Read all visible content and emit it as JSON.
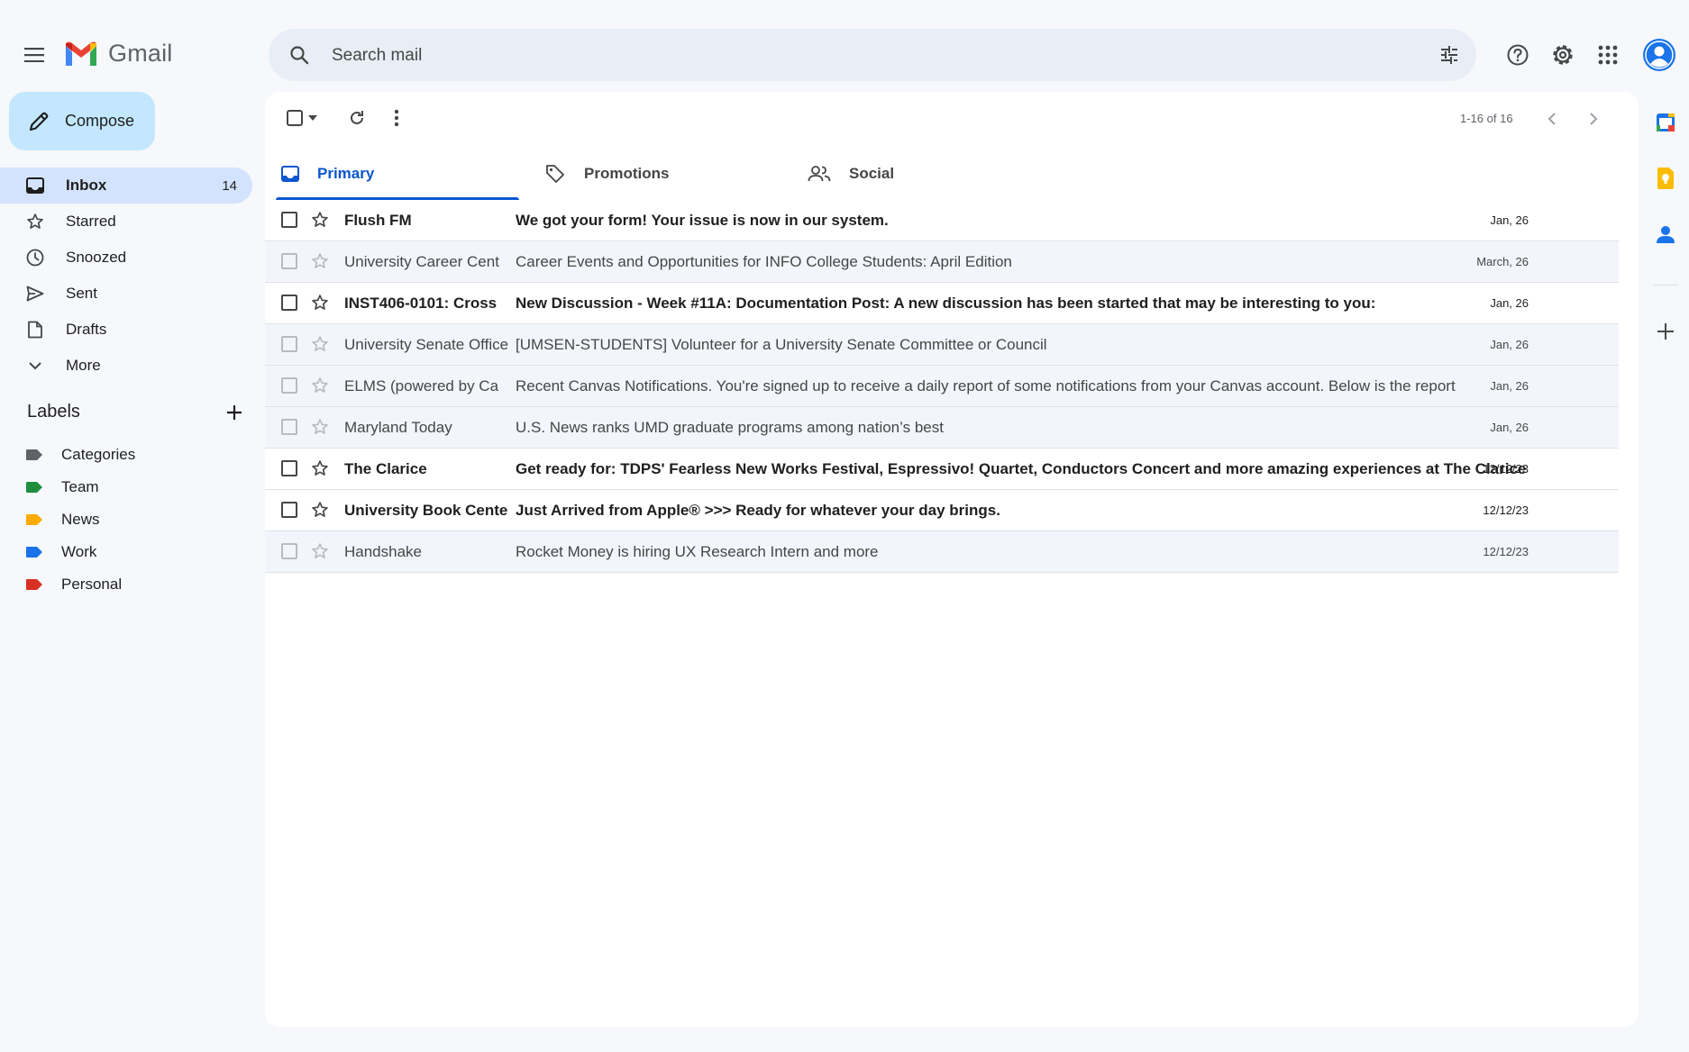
{
  "app": {
    "name": "Gmail"
  },
  "search": {
    "placeholder": "Search mail"
  },
  "compose": {
    "label": "Compose"
  },
  "nav": [
    {
      "label": "Inbox",
      "icon": "inbox-icon",
      "count": "14",
      "active": true
    },
    {
      "label": "Starred",
      "icon": "star-icon"
    },
    {
      "label": "Snoozed",
      "icon": "clock-icon"
    },
    {
      "label": "Sent",
      "icon": "send-icon"
    },
    {
      "label": "Drafts",
      "icon": "draft-icon"
    },
    {
      "label": "More",
      "icon": "chevron-down-icon"
    }
  ],
  "labels": {
    "title": "Labels",
    "items": [
      {
        "name": "Categories",
        "color": "#5f6368"
      },
      {
        "name": "Team",
        "color": "#1e8e3e"
      },
      {
        "name": "News",
        "color": "#f9ab00"
      },
      {
        "name": "Work",
        "color": "#1a73e8"
      },
      {
        "name": "Personal",
        "color": "#d93025"
      }
    ]
  },
  "toolbar": {
    "pagination": "1-16 of 16"
  },
  "tabs": [
    {
      "label": "Primary",
      "icon": "inbox-icon",
      "active": true
    },
    {
      "label": "Promotions",
      "icon": "tag-icon"
    },
    {
      "label": "Social",
      "icon": "people-icon"
    }
  ],
  "emails": [
    {
      "sender": "Flush FM",
      "subject": "We got your form! Your issue is now in our system.",
      "date": "Jan, 26",
      "unread": true
    },
    {
      "sender": "University Career Cent",
      "subject": "Career Events and Opportunities for INFO College Students: April Edition",
      "date": "March, 26",
      "unread": false
    },
    {
      "sender": "INST406-0101: Cross",
      "subject": "New Discussion - Week #11A: Documentation Post: A new discussion has been started that may be interesting to you:",
      "date": "Jan, 26",
      "unread": true
    },
    {
      "sender": "University Senate Office",
      "subject": "[UMSEN-STUDENTS] Volunteer for a University Senate Committee or Council",
      "date": "Jan, 26",
      "unread": false
    },
    {
      "sender": "ELMS (powered by Ca",
      "subject": "Recent Canvas Notifications. You're signed up to receive a daily report of some notifications from your Canvas account. Below is the report",
      "date": "Jan, 26",
      "unread": false
    },
    {
      "sender": "Maryland Today",
      "subject": "U.S. News ranks UMD graduate programs among nation’s best",
      "date": "Jan, 26",
      "unread": false
    },
    {
      "sender": "The Clarice",
      "subject": " Get ready for: TDPS' Fearless New Works Festival, Espressivo! Quartet, Conductors Concert and more amazing experiences at The Clarice",
      "date": "12/12/23",
      "unread": true
    },
    {
      "sender": "University Book Center",
      "subject": "Just Arrived from Apple® >>> Ready for whatever your day brings.",
      "date": "12/12/23",
      "unread": true
    },
    {
      "sender": "Handshake",
      "subject": "Rocket Money is hiring UX Research Intern and more",
      "date": "12/12/23",
      "unread": false
    }
  ],
  "colors": {
    "accent": "#0b57d0",
    "compose_bg": "#c2e7ff",
    "active_nav_bg": "#d3e3fd",
    "avatar": "#1a73e8"
  }
}
